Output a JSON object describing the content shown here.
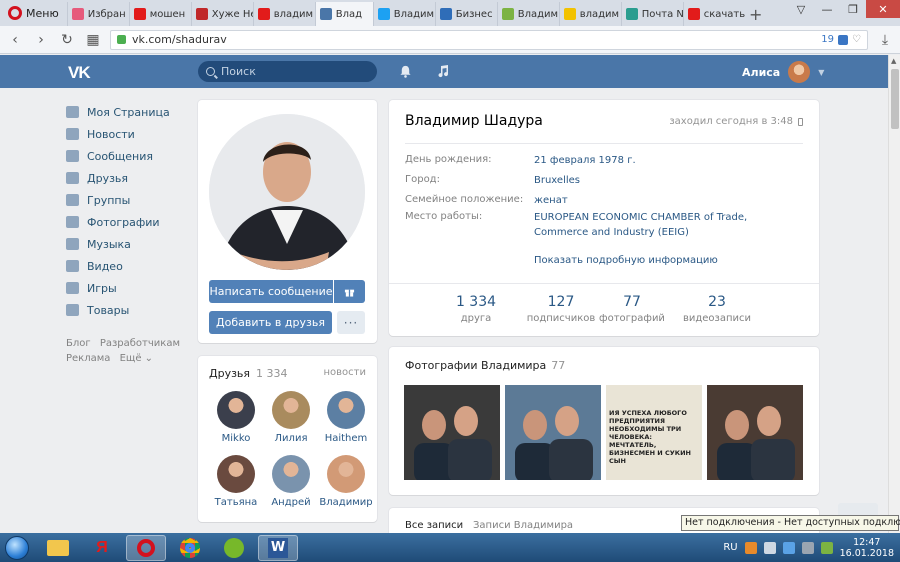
{
  "browser": {
    "menu_label": "Меню",
    "tabs": [
      {
        "label": "Избран",
        "color": "#e65a7c"
      },
      {
        "label": "мошен",
        "color": "#e21b1b"
      },
      {
        "label": "Хуже Не",
        "color": "#c0282a"
      },
      {
        "label": "владим",
        "color": "#e21b1b"
      },
      {
        "label": "Влад",
        "color": "#4a76a8",
        "active": true
      },
      {
        "label": "Владим",
        "color": "#1da1f2"
      },
      {
        "label": "Бизнес",
        "color": "#2f6db8"
      },
      {
        "label": "Владим",
        "color": "#7cb342"
      },
      {
        "label": "владим",
        "color": "#f2c200"
      },
      {
        "label": "Почта N",
        "color": "#2a9d8f"
      },
      {
        "label": "скачать",
        "color": "#e21b1b"
      }
    ],
    "url": "vk.com/shadurav",
    "url_badge": "19"
  },
  "vk": {
    "logo": "VK",
    "search_placeholder": "Поиск",
    "user_name": "Алиса"
  },
  "leftnav": {
    "items": [
      {
        "label": "Моя Страница",
        "icon": "home-icon"
      },
      {
        "label": "Новости",
        "icon": "news-icon"
      },
      {
        "label": "Сообщения",
        "icon": "messages-icon"
      },
      {
        "label": "Друзья",
        "icon": "friends-icon"
      },
      {
        "label": "Группы",
        "icon": "groups-icon"
      },
      {
        "label": "Фотографии",
        "icon": "photos-icon"
      },
      {
        "label": "Музыка",
        "icon": "music-icon"
      },
      {
        "label": "Видео",
        "icon": "video-icon"
      },
      {
        "label": "Игры",
        "icon": "games-icon"
      },
      {
        "label": "Товары",
        "icon": "goods-icon"
      }
    ],
    "footer": {
      "blog": "Блог",
      "developers": "Разработчикам",
      "ads": "Реклама",
      "more": "Ещё ⌄"
    }
  },
  "profile": {
    "send_message": "Написать сообщение",
    "add_friend": "Добавить в друзья",
    "more": "···",
    "name": "Владимир Шадура",
    "online": "заходил сегодня в 3:48",
    "fields": [
      {
        "label": "День рождения:",
        "value": "21 февраля 1978 г."
      },
      {
        "label": "Город:",
        "value": "Bruxelles"
      },
      {
        "label": "Семейное положение:",
        "value": "женат"
      },
      {
        "label": "Место работы:",
        "value": "EUROPEAN ECONOMIC CHAMBER of Trade, Commerce and Industry (EEIG)"
      }
    ],
    "show_more": "Показать подробную информацию",
    "counters": [
      {
        "value": "1 334",
        "label": "друга"
      },
      {
        "value": "127",
        "label": "подписчиков"
      },
      {
        "value": "77",
        "label": "фотографий"
      },
      {
        "value": "23",
        "label": "видеозаписи"
      }
    ]
  },
  "friends": {
    "title": "Друзья",
    "count": "1 334",
    "news": "новости",
    "list": [
      {
        "name": "Mikko",
        "color": "#3b3f4c"
      },
      {
        "name": "Лилия",
        "color": "#a98b5e"
      },
      {
        "name": "Haithem",
        "color": "#5c7fa3"
      },
      {
        "name": "Татьяна",
        "color": "#6a4a3f"
      },
      {
        "name": "Андрей",
        "color": "#7a93ad"
      },
      {
        "name": "Владимир",
        "color": "#d29a76"
      }
    ]
  },
  "photos": {
    "title": "Фотографии Владимира",
    "count": "77",
    "items": [
      {
        "color": "#3a3a3a"
      },
      {
        "color": "#5c7a96"
      },
      {
        "color": "#e9e4d6",
        "text": "ИЯ УСПЕХА ЛЮБОГО ПРЕДПРИЯТИЯ НЕОБХОДИМЫ ТРИ ЧЕЛОВЕКА: МЕЧТАТЕЛЬ, БИЗНЕСМЕН И СУКИН СЫН"
      },
      {
        "color": "#4a3b33"
      }
    ]
  },
  "wall": {
    "all": "Все записи",
    "own": "Записи Владимира"
  },
  "tooltip": "Нет подключения - Нет доступных подключений",
  "taskbar": {
    "lang": "RU",
    "time": "12:47",
    "date": "16.01.2018"
  }
}
